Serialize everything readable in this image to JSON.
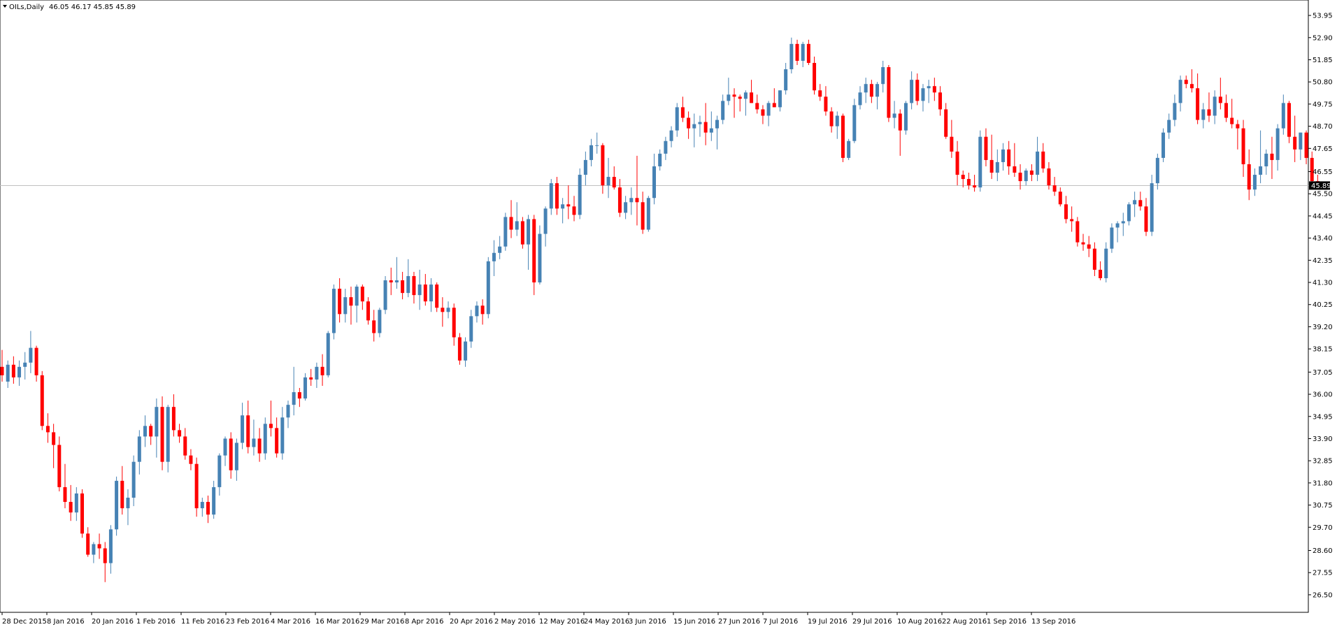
{
  "chart_data": {
    "type": "candlestick",
    "title": "OILs,Daily",
    "ohlc_header": "46.05 46.17 45.85 45.89",
    "current_price": "45.89",
    "ylim": [
      26.0,
      54.35
    ],
    "y_ticks": [
      "53.95",
      "52.90",
      "51.85",
      "50.80",
      "49.75",
      "48.70",
      "47.65",
      "46.55",
      "45.50",
      "44.45",
      "43.40",
      "42.35",
      "41.30",
      "40.25",
      "39.20",
      "38.15",
      "37.05",
      "36.00",
      "34.95",
      "33.90",
      "32.85",
      "31.80",
      "30.75",
      "29.70",
      "28.60",
      "27.55",
      "26.50"
    ],
    "x_labels": [
      "28 Dec 2015",
      "8 Jan 2016",
      "20 Jan 2016",
      "1 Feb 2016",
      "11 Feb 2016",
      "23 Feb 2016",
      "4 Mar 2016",
      "16 Mar 2016",
      "29 Mar 2016",
      "8 Apr 2016",
      "20 Apr 2016",
      "2 May 2016",
      "12 May 2016",
      "24 May 2016",
      "3 Jun 2016",
      "15 Jun 2016",
      "27 Jun 2016",
      "7 Jul 2016",
      "19 Jul 2016",
      "29 Jul 2016",
      "10 Aug 2016",
      "22 Aug 2016",
      "1 Sep 2016",
      "13 Sep 2016"
    ],
    "up_color": "#4682B4",
    "down_color": "#FF0000",
    "candles": [
      [
        37.3,
        38.1,
        36.6,
        36.9
      ],
      [
        36.6,
        37.6,
        36.3,
        37.4
      ],
      [
        37.4,
        37.8,
        36.5,
        36.8
      ],
      [
        36.8,
        37.6,
        36.4,
        37.3
      ],
      [
        37.3,
        38.0,
        36.7,
        37.5
      ],
      [
        37.5,
        39.0,
        37.0,
        38.2
      ],
      [
        38.2,
        38.3,
        36.6,
        36.9
      ],
      [
        36.9,
        37.1,
        34.3,
        34.5
      ],
      [
        34.5,
        35.1,
        33.7,
        34.2
      ],
      [
        34.2,
        34.6,
        32.5,
        33.6
      ],
      [
        33.6,
        34.0,
        31.4,
        31.6
      ],
      [
        31.6,
        32.7,
        30.6,
        30.9
      ],
      [
        30.9,
        31.7,
        30.0,
        30.4
      ],
      [
        30.4,
        31.6,
        30.0,
        31.3
      ],
      [
        31.3,
        31.5,
        29.2,
        29.4
      ],
      [
        29.4,
        29.7,
        28.3,
        28.4
      ],
      [
        28.4,
        29.0,
        28.0,
        28.9
      ],
      [
        28.9,
        29.4,
        28.2,
        28.7
      ],
      [
        28.7,
        29.0,
        27.1,
        28.0
      ],
      [
        28.0,
        29.8,
        27.5,
        29.6
      ],
      [
        29.6,
        32.1,
        29.3,
        31.9
      ],
      [
        31.9,
        32.6,
        30.3,
        30.6
      ],
      [
        30.6,
        31.5,
        29.8,
        31.1
      ],
      [
        31.1,
        33.1,
        30.7,
        32.8
      ],
      [
        32.8,
        34.3,
        32.2,
        34.0
      ],
      [
        34.0,
        35.0,
        33.5,
        34.5
      ],
      [
        34.5,
        34.6,
        33.6,
        34.0
      ],
      [
        34.0,
        35.8,
        33.0,
        35.4
      ],
      [
        35.4,
        35.9,
        32.4,
        32.8
      ],
      [
        32.8,
        35.5,
        32.3,
        35.4
      ],
      [
        35.4,
        36.0,
        34.0,
        34.3
      ],
      [
        34.3,
        34.6,
        33.7,
        34.0
      ],
      [
        34.0,
        34.4,
        32.9,
        33.1
      ],
      [
        33.1,
        33.4,
        32.4,
        32.7
      ],
      [
        32.7,
        33.0,
        30.2,
        30.6
      ],
      [
        30.6,
        31.1,
        30.2,
        30.9
      ],
      [
        30.9,
        31.2,
        29.9,
        30.3
      ],
      [
        30.3,
        31.9,
        30.1,
        31.6
      ],
      [
        31.6,
        33.2,
        31.2,
        33.1
      ],
      [
        33.1,
        34.0,
        32.6,
        33.9
      ],
      [
        33.9,
        34.2,
        32.0,
        32.4
      ],
      [
        32.4,
        33.9,
        31.9,
        33.7
      ],
      [
        33.7,
        35.6,
        33.4,
        35.0
      ],
      [
        35.0,
        35.7,
        33.2,
        33.5
      ],
      [
        33.5,
        34.8,
        33.1,
        33.9
      ],
      [
        33.9,
        34.4,
        32.8,
        33.2
      ],
      [
        33.2,
        34.9,
        32.9,
        34.6
      ],
      [
        34.6,
        35.7,
        34.0,
        34.4
      ],
      [
        34.4,
        34.9,
        33.0,
        33.2
      ],
      [
        33.2,
        35.4,
        32.9,
        34.9
      ],
      [
        34.9,
        35.7,
        34.4,
        35.5
      ],
      [
        35.5,
        37.3,
        35.0,
        36.1
      ],
      [
        36.1,
        36.3,
        35.4,
        35.8
      ],
      [
        35.8,
        37.0,
        35.7,
        36.8
      ],
      [
        36.8,
        37.2,
        36.4,
        36.7
      ],
      [
        36.7,
        37.5,
        36.3,
        37.3
      ],
      [
        37.3,
        37.9,
        36.4,
        36.9
      ],
      [
        36.9,
        39.0,
        36.8,
        38.9
      ],
      [
        38.9,
        41.2,
        38.6,
        41.0
      ],
      [
        41.0,
        41.5,
        39.4,
        39.8
      ],
      [
        39.8,
        41.0,
        39.4,
        40.6
      ],
      [
        40.6,
        41.1,
        39.3,
        40.2
      ],
      [
        40.2,
        41.2,
        39.4,
        41.1
      ],
      [
        41.1,
        41.2,
        40.0,
        40.4
      ],
      [
        40.4,
        40.6,
        39.3,
        39.5
      ],
      [
        39.5,
        40.0,
        38.5,
        38.9
      ],
      [
        38.9,
        40.1,
        38.7,
        40.0
      ],
      [
        40.0,
        41.6,
        39.8,
        41.4
      ],
      [
        41.4,
        42.0,
        40.7,
        41.3
      ],
      [
        41.3,
        42.5,
        41.0,
        41.4
      ],
      [
        41.4,
        41.8,
        40.5,
        40.8
      ],
      [
        40.8,
        42.4,
        40.6,
        41.6
      ],
      [
        41.6,
        41.8,
        40.3,
        40.7
      ],
      [
        40.7,
        41.9,
        40.0,
        41.2
      ],
      [
        41.2,
        41.7,
        40.2,
        40.4
      ],
      [
        40.4,
        41.5,
        39.9,
        41.2
      ],
      [
        41.2,
        41.3,
        39.9,
        40.1
      ],
      [
        40.1,
        40.6,
        39.2,
        39.9
      ],
      [
        39.9,
        40.4,
        39.6,
        40.1
      ],
      [
        40.1,
        40.3,
        38.3,
        38.7
      ],
      [
        38.7,
        38.9,
        37.4,
        37.6
      ],
      [
        37.6,
        38.7,
        37.3,
        38.5
      ],
      [
        38.5,
        40.0,
        38.2,
        39.7
      ],
      [
        39.7,
        40.4,
        39.4,
        40.2
      ],
      [
        40.2,
        40.5,
        39.3,
        39.8
      ],
      [
        39.8,
        42.5,
        39.6,
        42.3
      ],
      [
        42.3,
        43.3,
        41.6,
        42.7
      ],
      [
        42.7,
        43.5,
        42.4,
        43.0
      ],
      [
        43.0,
        44.6,
        42.8,
        44.4
      ],
      [
        44.4,
        45.2,
        43.4,
        43.8
      ],
      [
        43.8,
        45.1,
        43.5,
        44.2
      ],
      [
        44.2,
        44.4,
        42.9,
        43.1
      ],
      [
        43.1,
        44.5,
        41.9,
        44.3
      ],
      [
        44.3,
        44.5,
        40.7,
        41.3
      ],
      [
        41.3,
        44.0,
        41.2,
        43.6
      ],
      [
        43.6,
        44.9,
        43.0,
        44.8
      ],
      [
        44.8,
        46.2,
        44.5,
        46.0
      ],
      [
        46.0,
        46.3,
        44.5,
        44.8
      ],
      [
        44.8,
        45.3,
        44.1,
        45.0
      ],
      [
        45.0,
        45.9,
        44.3,
        44.9
      ],
      [
        44.9,
        45.4,
        44.2,
        44.5
      ],
      [
        44.5,
        46.7,
        44.3,
        46.4
      ],
      [
        46.4,
        47.5,
        45.9,
        47.1
      ],
      [
        47.1,
        48.1,
        46.8,
        47.8
      ],
      [
        47.8,
        48.4,
        47.4,
        47.8
      ],
      [
        47.8,
        47.9,
        45.5,
        45.9
      ],
      [
        45.9,
        47.2,
        45.3,
        46.3
      ],
      [
        46.3,
        46.8,
        45.7,
        45.8
      ],
      [
        45.8,
        46.2,
        44.4,
        44.6
      ],
      [
        44.6,
        45.4,
        44.3,
        45.1
      ],
      [
        45.1,
        45.8,
        44.5,
        45.3
      ],
      [
        45.3,
        47.3,
        44.0,
        45.1
      ],
      [
        45.1,
        45.6,
        43.6,
        43.8
      ],
      [
        43.8,
        45.4,
        43.7,
        45.3
      ],
      [
        45.3,
        47.4,
        45.0,
        46.8
      ],
      [
        46.8,
        47.6,
        46.6,
        47.4
      ],
      [
        47.4,
        48.2,
        47.1,
        48.0
      ],
      [
        48.0,
        48.7,
        47.7,
        48.5
      ],
      [
        48.5,
        49.8,
        48.2,
        49.6
      ],
      [
        49.6,
        50.1,
        48.9,
        49.1
      ],
      [
        49.1,
        49.4,
        48.1,
        48.6
      ],
      [
        48.6,
        49.3,
        47.7,
        48.8
      ],
      [
        48.8,
        49.2,
        48.2,
        48.9
      ],
      [
        48.9,
        49.8,
        47.8,
        48.4
      ],
      [
        48.4,
        49.4,
        48.0,
        48.6
      ],
      [
        48.6,
        49.2,
        47.6,
        49.0
      ],
      [
        49.0,
        50.2,
        48.8,
        49.9
      ],
      [
        49.9,
        51.0,
        49.7,
        50.2
      ],
      [
        50.2,
        50.5,
        49.1,
        50.1
      ],
      [
        50.1,
        50.2,
        49.4,
        50.0
      ],
      [
        50.0,
        50.4,
        49.2,
        50.3
      ],
      [
        50.3,
        50.9,
        49.8,
        49.8
      ],
      [
        49.8,
        50.2,
        49.3,
        49.5
      ],
      [
        49.5,
        49.7,
        48.8,
        49.2
      ],
      [
        49.2,
        49.9,
        48.7,
        49.8
      ],
      [
        49.8,
        50.5,
        49.6,
        49.6
      ],
      [
        49.6,
        50.4,
        49.4,
        50.4
      ],
      [
        50.4,
        51.7,
        50.2,
        51.4
      ],
      [
        51.4,
        52.9,
        51.2,
        52.6
      ],
      [
        52.6,
        52.8,
        51.6,
        51.8
      ],
      [
        51.8,
        52.7,
        51.5,
        52.6
      ],
      [
        52.6,
        52.8,
        51.6,
        51.7
      ],
      [
        51.7,
        52.0,
        50.2,
        50.4
      ],
      [
        50.4,
        50.7,
        49.9,
        50.1
      ],
      [
        50.1,
        50.6,
        49.2,
        49.4
      ],
      [
        49.4,
        49.6,
        48.4,
        48.7
      ],
      [
        48.7,
        49.4,
        48.1,
        49.2
      ],
      [
        49.2,
        49.3,
        47.0,
        47.2
      ],
      [
        47.2,
        48.1,
        47.1,
        48.0
      ],
      [
        48.0,
        50.0,
        47.9,
        49.7
      ],
      [
        49.7,
        50.6,
        49.5,
        50.3
      ],
      [
        50.3,
        51.0,
        49.8,
        50.7
      ],
      [
        50.7,
        50.9,
        49.8,
        50.1
      ],
      [
        50.1,
        50.8,
        49.5,
        50.7
      ],
      [
        50.7,
        51.8,
        50.3,
        51.5
      ],
      [
        51.5,
        51.6,
        48.9,
        49.1
      ],
      [
        49.1,
        49.9,
        48.6,
        49.3
      ],
      [
        49.3,
        49.5,
        47.3,
        48.5
      ],
      [
        48.5,
        49.9,
        48.3,
        49.8
      ],
      [
        49.8,
        51.3,
        49.5,
        50.9
      ],
      [
        50.9,
        51.2,
        49.7,
        49.9
      ],
      [
        49.9,
        50.7,
        49.4,
        50.5
      ],
      [
        50.5,
        50.9,
        49.8,
        50.6
      ],
      [
        50.6,
        51.0,
        49.9,
        50.3
      ],
      [
        50.3,
        50.6,
        49.2,
        49.5
      ],
      [
        49.5,
        49.8,
        48.1,
        48.2
      ],
      [
        48.2,
        49.0,
        47.2,
        47.5
      ],
      [
        47.5,
        48.0,
        45.9,
        46.4
      ],
      [
        46.4,
        46.6,
        45.8,
        46.2
      ],
      [
        46.2,
        46.5,
        45.7,
        45.9
      ],
      [
        45.9,
        46.4,
        45.6,
        45.8
      ],
      [
        45.8,
        48.5,
        45.6,
        48.2
      ],
      [
        48.2,
        48.6,
        46.8,
        47.1
      ],
      [
        47.1,
        48.3,
        46.2,
        46.5
      ],
      [
        46.5,
        47.6,
        46.1,
        47.0
      ],
      [
        47.0,
        47.9,
        46.6,
        47.6
      ],
      [
        47.6,
        48.0,
        46.4,
        46.8
      ],
      [
        46.8,
        47.9,
        46.3,
        46.5
      ],
      [
        46.5,
        46.9,
        45.7,
        46.1
      ],
      [
        46.1,
        46.7,
        45.9,
        46.6
      ],
      [
        46.6,
        46.9,
        46.1,
        46.4
      ],
      [
        46.4,
        48.2,
        46.1,
        47.5
      ],
      [
        47.5,
        47.9,
        46.5,
        46.7
      ],
      [
        46.7,
        47.0,
        45.7,
        45.9
      ],
      [
        45.9,
        46.3,
        45.4,
        45.6
      ],
      [
        45.6,
        45.8,
        44.9,
        45.0
      ],
      [
        45.0,
        45.4,
        44.1,
        44.3
      ],
      [
        44.3,
        44.9,
        43.7,
        44.2
      ],
      [
        44.2,
        44.4,
        43.0,
        43.2
      ],
      [
        43.2,
        43.6,
        42.8,
        43.1
      ],
      [
        43.1,
        43.5,
        42.5,
        42.9
      ],
      [
        42.9,
        43.2,
        41.6,
        41.9
      ],
      [
        41.9,
        42.3,
        41.4,
        41.5
      ],
      [
        41.5,
        43.2,
        41.3,
        42.9
      ],
      [
        42.9,
        44.1,
        42.7,
        43.9
      ],
      [
        43.9,
        44.2,
        43.2,
        44.1
      ],
      [
        44.1,
        44.6,
        43.5,
        44.2
      ],
      [
        44.2,
        45.1,
        44.0,
        45.0
      ],
      [
        45.0,
        45.6,
        44.4,
        45.2
      ],
      [
        45.2,
        45.6,
        44.7,
        44.9
      ],
      [
        44.9,
        45.3,
        43.5,
        43.7
      ],
      [
        43.7,
        46.4,
        43.5,
        46.0
      ],
      [
        46.0,
        47.4,
        45.7,
        47.2
      ],
      [
        47.2,
        48.6,
        47.0,
        48.4
      ],
      [
        48.4,
        49.3,
        48.1,
        49.0
      ],
      [
        49.0,
        50.2,
        48.7,
        49.8
      ],
      [
        49.8,
        51.1,
        49.4,
        50.9
      ],
      [
        50.9,
        51.1,
        50.5,
        50.7
      ],
      [
        50.7,
        51.4,
        50.3,
        50.5
      ],
      [
        50.5,
        51.2,
        48.8,
        49.0
      ],
      [
        49.0,
        49.8,
        48.6,
        49.5
      ],
      [
        49.5,
        50.3,
        48.9,
        49.2
      ],
      [
        49.2,
        50.4,
        48.8,
        50.1
      ],
      [
        50.1,
        51.0,
        49.5,
        49.8
      ],
      [
        49.8,
        50.2,
        48.9,
        49.1
      ],
      [
        49.1,
        50.0,
        48.6,
        48.8
      ],
      [
        48.8,
        49.0,
        47.6,
        48.6
      ],
      [
        48.6,
        49.0,
        46.3,
        46.9
      ],
      [
        46.9,
        47.6,
        45.2,
        45.7
      ],
      [
        45.7,
        46.7,
        45.4,
        46.4
      ],
      [
        46.4,
        48.5,
        46.0,
        46.8
      ],
      [
        46.8,
        47.6,
        46.4,
        47.4
      ],
      [
        47.4,
        48.2,
        46.2,
        47.1
      ],
      [
        47.1,
        48.8,
        46.6,
        48.6
      ],
      [
        48.6,
        50.2,
        48.3,
        49.8
      ],
      [
        49.8,
        49.9,
        47.9,
        48.2
      ],
      [
        48.2,
        49.2,
        47.0,
        47.6
      ],
      [
        47.6,
        48.4,
        47.1,
        48.4
      ],
      [
        48.4,
        48.5,
        46.9,
        47.2
      ],
      [
        47.2,
        47.5,
        46.0,
        46.1
      ],
      [
        46.1,
        46.4,
        45.7,
        45.9
      ]
    ]
  }
}
